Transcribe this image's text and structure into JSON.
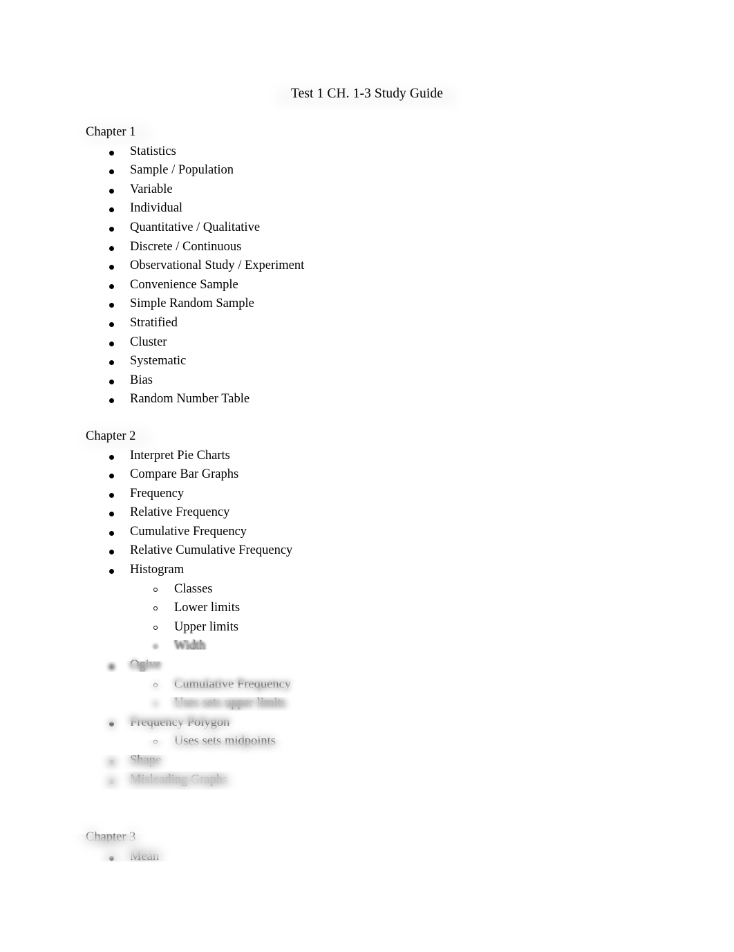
{
  "document": {
    "title": "Test 1 CH. 1-3 Study Guide",
    "background_color": "#ffffff",
    "text_color": "#000000"
  },
  "sections": [
    {
      "heading": "Chapter 1",
      "items": [
        {
          "text": "Statistics"
        },
        {
          "text": "Sample / Population"
        },
        {
          "text": "Variable"
        },
        {
          "text": "Individual"
        },
        {
          "text": "Quantitative / Qualitative"
        },
        {
          "text": "Discrete / Continuous"
        },
        {
          "text": "Observational Study / Experiment"
        },
        {
          "text": "Convenience Sample"
        },
        {
          "text": "Simple Random Sample"
        },
        {
          "text": "Stratified"
        },
        {
          "text": "Cluster"
        },
        {
          "text": "Systematic"
        },
        {
          "text": "Bias"
        },
        {
          "text": "Random Number Table"
        }
      ]
    },
    {
      "heading": "Chapter 2",
      "items": [
        {
          "text": "Interpret Pie Charts"
        },
        {
          "text": "Compare Bar Graphs"
        },
        {
          "text": "Frequency"
        },
        {
          "text": "Relative Frequency"
        },
        {
          "text": "Cumulative Frequency"
        },
        {
          "text": "Relative Cumulative Frequency"
        },
        {
          "text": "Histogram"
        }
      ],
      "histogram_sub_items": [
        {
          "text": "Classes"
        },
        {
          "text": "Lower limits"
        },
        {
          "text": "Upper limits"
        },
        {
          "text": "Width"
        }
      ],
      "trailing_items": [
        {
          "text": "Ogive",
          "sub_items": [
            {
              "text": "Cumulative Frequency"
            },
            {
              "text": "Uses sets upper limits"
            }
          ]
        },
        {
          "text": "Frequency Polygon",
          "sub_items": [
            {
              "text": "Uses sets midpoints"
            }
          ]
        },
        {
          "text": "Shape",
          "sub_items": []
        },
        {
          "text": "Misleading Graphs",
          "sub_items": []
        }
      ]
    },
    {
      "heading": "Chapter 3",
      "items": [
        {
          "text": "Mean"
        }
      ]
    }
  ],
  "render": {
    "blur_note": "lower portion of page progressively blurred"
  }
}
